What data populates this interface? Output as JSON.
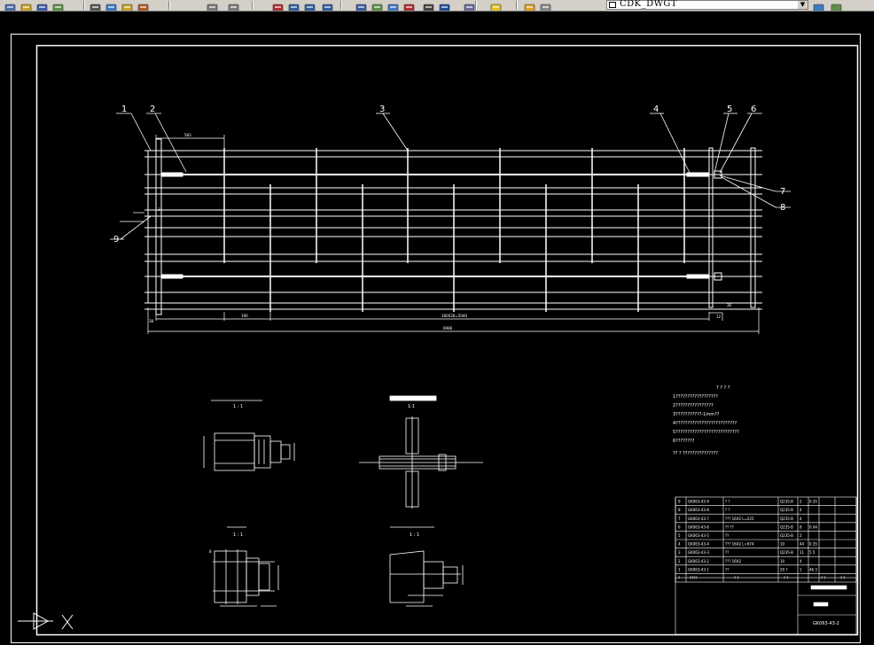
{
  "toolbar": {
    "buttons": [
      {
        "name": "new-icon",
        "color": "#4a6ea9"
      },
      {
        "name": "open-icon",
        "color": "#c9a227"
      },
      {
        "name": "save-icon",
        "color": "#3b5ba5"
      },
      {
        "name": "plot-icon",
        "color": "#5f8f4a"
      },
      {
        "name": "cut-icon",
        "color": "#555555"
      },
      {
        "name": "copy-icon",
        "color": "#3b79c4"
      },
      {
        "name": "paste-icon",
        "color": "#c9a227"
      },
      {
        "name": "match-properties-icon",
        "color": "#b05a2a"
      },
      {
        "name": "undo-icon",
        "color": "#7a7a7a"
      },
      {
        "name": "redo-icon",
        "color": "#7a7a7a"
      },
      {
        "name": "pan-icon",
        "color": "#b03030"
      },
      {
        "name": "zoom-realtime-icon",
        "color": "#3060a0"
      },
      {
        "name": "zoom-window-icon",
        "color": "#3060a0"
      },
      {
        "name": "zoom-previous-icon",
        "color": "#3060a0"
      },
      {
        "name": "properties-icon",
        "color": "#3b5ba5"
      },
      {
        "name": "design-center-icon",
        "color": "#5f8f4a"
      },
      {
        "name": "tool-palettes-icon",
        "color": "#3b79c4"
      },
      {
        "name": "sheet-set-icon",
        "color": "#b03030"
      },
      {
        "name": "calculator-icon",
        "color": "#444444"
      },
      {
        "name": "help-icon",
        "color": "#1f4fa0"
      },
      {
        "name": "layer-manager-icon",
        "color": "#6a6a9a"
      },
      {
        "name": "layer-on-icon",
        "color": "#e0c020"
      },
      {
        "name": "layer-freeze-icon",
        "color": "#e0a020"
      },
      {
        "name": "layer-lock-icon",
        "color": "#8a8a8a"
      }
    ],
    "layer": {
      "name": "CDK_DWGT"
    },
    "right_buttons": [
      {
        "name": "make-layer-current-icon",
        "color": "#3b79c4"
      },
      {
        "name": "layer-previous-icon",
        "color": "#5f8f4a"
      }
    ]
  },
  "drawing": {
    "balloons": [
      "1",
      "2",
      "3",
      "4",
      "5",
      "6",
      "7",
      "8",
      "9"
    ],
    "dims": {
      "overall": "6986",
      "span": "180X28=5040",
      "first_gap": "190",
      "left_end": "38",
      "right_gap": "12",
      "right_end": "36",
      "top_left": "583"
    },
    "detail_scales": [
      "1 : 1",
      "1:1",
      "1 : 1",
      "1 : 1"
    ],
    "notes_title": "? ? ? ?",
    "notes": [
      "1??????????????????",
      "2????????????????",
      "3???????????-1mm??",
      "4??????????????????????????",
      "5???????????????????????????",
      "6????????",
      "?? ? ???????????????"
    ],
    "bom": [
      {
        "no": "9",
        "code": "GK063-43-9",
        "name": "? ?",
        "material": "Q235-B",
        "qty": "2",
        "weight": "0.35"
      },
      {
        "no": "8",
        "code": "GK063-43-8",
        "name": "? ?",
        "material": "Q235-B",
        "qty": "4",
        "weight": ""
      },
      {
        "no": "7",
        "code": "GK063-43-7",
        "name": "??? 16X2 L=225",
        "material": "Q235-B",
        "qty": "4",
        "weight": ""
      },
      {
        "no": "6",
        "code": "GK063-43-6",
        "name": "?? ??",
        "material": "Q235-B",
        "qty": "8",
        "weight": "0.04"
      },
      {
        "no": "5",
        "code": "GK063-43-5",
        "name": "??",
        "material": "Q235-B",
        "qty": "2",
        "weight": ""
      },
      {
        "no": "4",
        "code": "GK063-43-4",
        "name": "??? 16X2 L=674",
        "material": "10",
        "qty": "44",
        "weight": "0.35"
      },
      {
        "no": "3",
        "code": "GK063-43-3",
        "name": "??",
        "material": "Q235-B",
        "qty": "11",
        "weight": "5.5"
      },
      {
        "no": "2",
        "code": "GK063-43-2",
        "name": "??? 16X2",
        "material": "10",
        "qty": "4",
        "weight": ""
      },
      {
        "no": "1",
        "code": "GK063-43-1",
        "name": "??",
        "material": "20 ?",
        "qty": "1",
        "weight": "46.3"
      }
    ],
    "bom_header": {
      "no": "?",
      "code": "????",
      "name": "? ?",
      "qty": "? ?",
      "material": "? ?",
      "weight": "? ?"
    },
    "title_block": {
      "drawing_no": "GK063-43-2"
    }
  },
  "colors": {
    "paper": "#000000",
    "line": "#ffffff",
    "toolbar": "#d4d0c8"
  }
}
